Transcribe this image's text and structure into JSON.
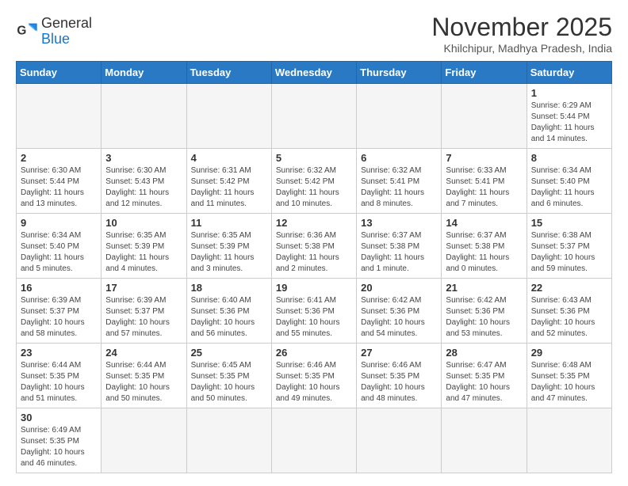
{
  "logo": {
    "general": "General",
    "blue": "Blue"
  },
  "header": {
    "month": "November 2025",
    "location": "Khilchipur, Madhya Pradesh, India"
  },
  "weekdays": [
    "Sunday",
    "Monday",
    "Tuesday",
    "Wednesday",
    "Thursday",
    "Friday",
    "Saturday"
  ],
  "days": [
    {
      "number": "",
      "info": ""
    },
    {
      "number": "",
      "info": ""
    },
    {
      "number": "",
      "info": ""
    },
    {
      "number": "",
      "info": ""
    },
    {
      "number": "",
      "info": ""
    },
    {
      "number": "",
      "info": ""
    },
    {
      "number": "1",
      "info": "Sunrise: 6:29 AM\nSunset: 5:44 PM\nDaylight: 11 hours and 14 minutes."
    },
    {
      "number": "2",
      "info": "Sunrise: 6:30 AM\nSunset: 5:44 PM\nDaylight: 11 hours and 13 minutes."
    },
    {
      "number": "3",
      "info": "Sunrise: 6:30 AM\nSunset: 5:43 PM\nDaylight: 11 hours and 12 minutes."
    },
    {
      "number": "4",
      "info": "Sunrise: 6:31 AM\nSunset: 5:42 PM\nDaylight: 11 hours and 11 minutes."
    },
    {
      "number": "5",
      "info": "Sunrise: 6:32 AM\nSunset: 5:42 PM\nDaylight: 11 hours and 10 minutes."
    },
    {
      "number": "6",
      "info": "Sunrise: 6:32 AM\nSunset: 5:41 PM\nDaylight: 11 hours and 8 minutes."
    },
    {
      "number": "7",
      "info": "Sunrise: 6:33 AM\nSunset: 5:41 PM\nDaylight: 11 hours and 7 minutes."
    },
    {
      "number": "8",
      "info": "Sunrise: 6:34 AM\nSunset: 5:40 PM\nDaylight: 11 hours and 6 minutes."
    },
    {
      "number": "9",
      "info": "Sunrise: 6:34 AM\nSunset: 5:40 PM\nDaylight: 11 hours and 5 minutes."
    },
    {
      "number": "10",
      "info": "Sunrise: 6:35 AM\nSunset: 5:39 PM\nDaylight: 11 hours and 4 minutes."
    },
    {
      "number": "11",
      "info": "Sunrise: 6:35 AM\nSunset: 5:39 PM\nDaylight: 11 hours and 3 minutes."
    },
    {
      "number": "12",
      "info": "Sunrise: 6:36 AM\nSunset: 5:38 PM\nDaylight: 11 hours and 2 minutes."
    },
    {
      "number": "13",
      "info": "Sunrise: 6:37 AM\nSunset: 5:38 PM\nDaylight: 11 hours and 1 minute."
    },
    {
      "number": "14",
      "info": "Sunrise: 6:37 AM\nSunset: 5:38 PM\nDaylight: 11 hours and 0 minutes."
    },
    {
      "number": "15",
      "info": "Sunrise: 6:38 AM\nSunset: 5:37 PM\nDaylight: 10 hours and 59 minutes."
    },
    {
      "number": "16",
      "info": "Sunrise: 6:39 AM\nSunset: 5:37 PM\nDaylight: 10 hours and 58 minutes."
    },
    {
      "number": "17",
      "info": "Sunrise: 6:39 AM\nSunset: 5:37 PM\nDaylight: 10 hours and 57 minutes."
    },
    {
      "number": "18",
      "info": "Sunrise: 6:40 AM\nSunset: 5:36 PM\nDaylight: 10 hours and 56 minutes."
    },
    {
      "number": "19",
      "info": "Sunrise: 6:41 AM\nSunset: 5:36 PM\nDaylight: 10 hours and 55 minutes."
    },
    {
      "number": "20",
      "info": "Sunrise: 6:42 AM\nSunset: 5:36 PM\nDaylight: 10 hours and 54 minutes."
    },
    {
      "number": "21",
      "info": "Sunrise: 6:42 AM\nSunset: 5:36 PM\nDaylight: 10 hours and 53 minutes."
    },
    {
      "number": "22",
      "info": "Sunrise: 6:43 AM\nSunset: 5:36 PM\nDaylight: 10 hours and 52 minutes."
    },
    {
      "number": "23",
      "info": "Sunrise: 6:44 AM\nSunset: 5:35 PM\nDaylight: 10 hours and 51 minutes."
    },
    {
      "number": "24",
      "info": "Sunrise: 6:44 AM\nSunset: 5:35 PM\nDaylight: 10 hours and 50 minutes."
    },
    {
      "number": "25",
      "info": "Sunrise: 6:45 AM\nSunset: 5:35 PM\nDaylight: 10 hours and 50 minutes."
    },
    {
      "number": "26",
      "info": "Sunrise: 6:46 AM\nSunset: 5:35 PM\nDaylight: 10 hours and 49 minutes."
    },
    {
      "number": "27",
      "info": "Sunrise: 6:46 AM\nSunset: 5:35 PM\nDaylight: 10 hours and 48 minutes."
    },
    {
      "number": "28",
      "info": "Sunrise: 6:47 AM\nSunset: 5:35 PM\nDaylight: 10 hours and 47 minutes."
    },
    {
      "number": "29",
      "info": "Sunrise: 6:48 AM\nSunset: 5:35 PM\nDaylight: 10 hours and 47 minutes."
    },
    {
      "number": "30",
      "info": "Sunrise: 6:49 AM\nSunset: 5:35 PM\nDaylight: 10 hours and 46 minutes."
    }
  ]
}
